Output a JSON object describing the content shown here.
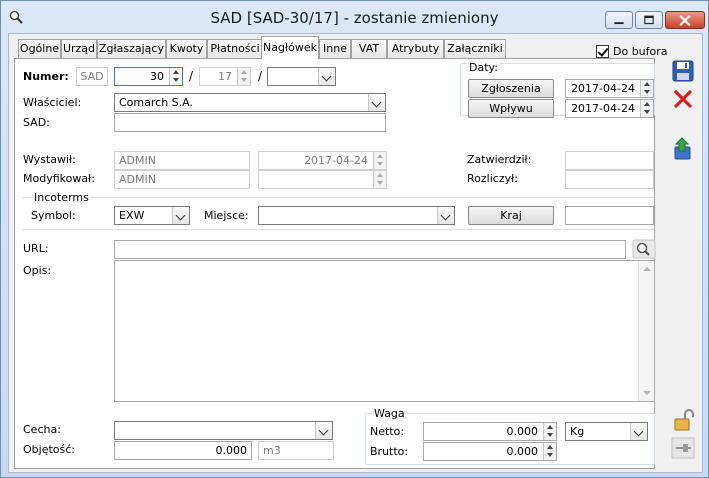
{
  "window": {
    "title": "SAD [SAD-30/17]  - zostanie zmieniony"
  },
  "tabs": [
    {
      "label": "Ogólne"
    },
    {
      "label": "Urząd"
    },
    {
      "label": "Zgłaszający"
    },
    {
      "label": "Kwoty"
    },
    {
      "label": "Płatności"
    },
    {
      "label": "Nagłówek"
    },
    {
      "label": "Inne"
    },
    {
      "label": "VAT"
    },
    {
      "label": "Atrybuty"
    },
    {
      "label": "Załączniki"
    }
  ],
  "do_bufora": {
    "label": "Do bufora",
    "checked": true
  },
  "numer": {
    "label": "Numer:",
    "prefix": "SAD",
    "number": "30",
    "sep1": "/",
    "year": "17",
    "sep2": "/",
    "series": ""
  },
  "wlasciciel": {
    "label": "Właściciel:",
    "value": "Comarch S.A."
  },
  "sad": {
    "label": "SAD:",
    "value": ""
  },
  "daty": {
    "label": "Daty:",
    "zgloszenia_label": "Zgłoszenia",
    "zgloszenia_value": "2017-04-24",
    "wplywu_label": "Wpływu",
    "wplywu_value": "2017-04-24"
  },
  "wystawil": {
    "label": "Wystawił:",
    "user": "ADMIN",
    "date": "2017-04-24"
  },
  "modyfikowal": {
    "label": "Modyfikował:",
    "user": "ADMIN",
    "date": ""
  },
  "zatwierdzil": {
    "label": "Zatwierdził:",
    "value": ""
  },
  "rozliczyl": {
    "label": "Rozliczył:",
    "value": ""
  },
  "incoterms": {
    "label": "Incoterms",
    "symbol_label": "Symbol:",
    "symbol_value": "EXW",
    "miejsce_label": "Miejsce:",
    "miejsce_value": "",
    "kraj_label": "Kraj",
    "kraj_value": ""
  },
  "url": {
    "label": "URL:",
    "value": ""
  },
  "opis": {
    "label": "Opis:",
    "value": ""
  },
  "cecha": {
    "label": "Cecha:",
    "value": ""
  },
  "objetosc": {
    "label": "Objętość:",
    "value": "0.000",
    "unit": "m3"
  },
  "waga": {
    "label": "Waga",
    "netto_label": "Netto:",
    "netto_value": "0.000",
    "unit": "Kg",
    "brutto_label": "Brutto:",
    "brutto_value": "0.000"
  },
  "toolbar": {
    "save_icon": "save-icon",
    "cancel_icon": "close-icon",
    "export_icon": "export-icon",
    "lock_icon": "lock-icon",
    "pin_icon": "pin-icon",
    "colors": {
      "save": "#2f5fb3",
      "cancel": "#d42020",
      "export": "#3aa64a"
    }
  }
}
